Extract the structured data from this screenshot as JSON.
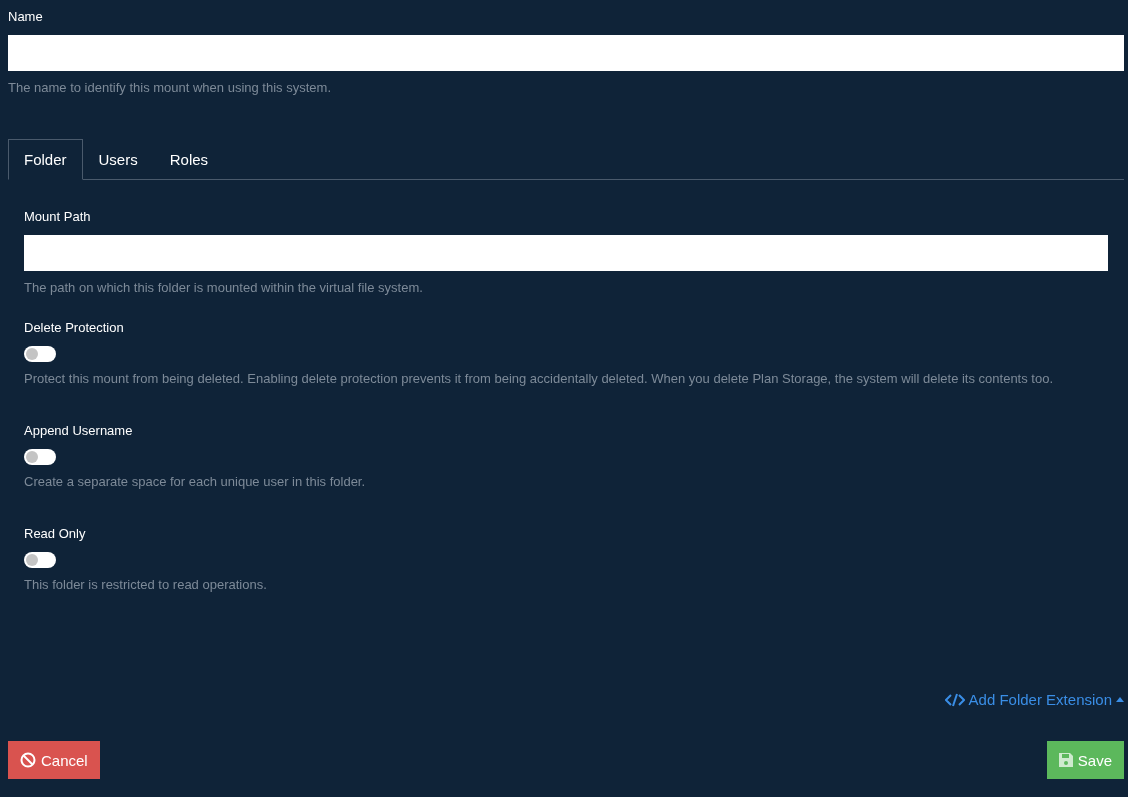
{
  "name_field": {
    "label": "Name",
    "help": "The name to identify this mount when using this system."
  },
  "tabs": [
    {
      "label": "Folder",
      "selected": true
    },
    {
      "label": "Users",
      "selected": false
    },
    {
      "label": "Roles",
      "selected": false
    }
  ],
  "mount_path": {
    "label": "Mount Path",
    "help": "The path on which this folder is mounted within the virtual file system."
  },
  "toggles": [
    {
      "label": "Delete Protection",
      "on": false,
      "help": "Protect this mount from being deleted. Enabling delete protection prevents it from being accidentally deleted. When you delete Plan Storage, the system will delete its contents too."
    },
    {
      "label": "Append Username",
      "on": false,
      "help": "Create a separate space for each unique user in this folder."
    },
    {
      "label": "Read Only",
      "on": false,
      "help": "This folder is restricted to read operations."
    }
  ],
  "extension_link": "Add Folder Extension",
  "buttons": {
    "cancel": "Cancel",
    "save": "Save"
  }
}
